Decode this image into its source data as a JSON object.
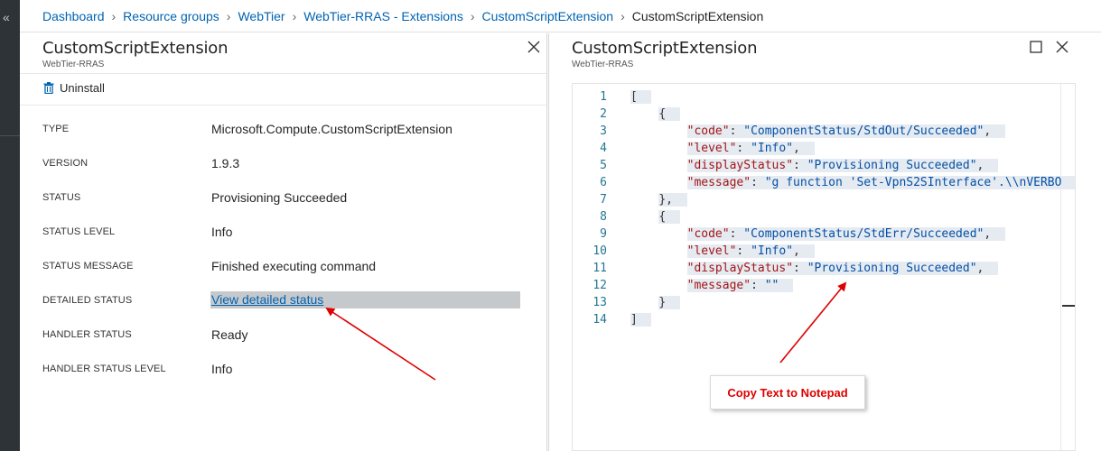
{
  "breadcrumb": {
    "items": [
      "Dashboard",
      "Resource groups",
      "WebTier",
      "WebTier-RRAS - Extensions",
      "CustomScriptExtension"
    ],
    "current": "CustomScriptExtension"
  },
  "rail": {
    "collapse_glyph": "«"
  },
  "left_pane": {
    "title": "CustomScriptExtension",
    "subtitle": "WebTier-RRAS",
    "uninstall_label": "Uninstall",
    "properties": [
      {
        "label": "TYPE",
        "value": "Microsoft.Compute.CustomScriptExtension"
      },
      {
        "label": "VERSION",
        "value": "1.9.3"
      },
      {
        "label": "STATUS",
        "value": "Provisioning Succeeded"
      },
      {
        "label": "STATUS LEVEL",
        "value": "Info"
      },
      {
        "label": "STATUS MESSAGE",
        "value": "Finished executing command"
      },
      {
        "label": "DETAILED STATUS",
        "value": "View detailed status"
      },
      {
        "label": "HANDLER STATUS",
        "value": "Ready"
      },
      {
        "label": "HANDLER STATUS LEVEL",
        "value": "Info"
      }
    ]
  },
  "right_pane": {
    "title": "CustomScriptExtension",
    "subtitle": "WebTier-RRAS",
    "code_lines": [
      {
        "n": "1",
        "text": "["
      },
      {
        "n": "2",
        "text": "    {"
      },
      {
        "n": "3",
        "indent": "        ",
        "key": "\"code\"",
        "value": "\"ComponentStatus/StdOut/Succeeded\"",
        "trail": ","
      },
      {
        "n": "4",
        "indent": "        ",
        "key": "\"level\"",
        "value": "\"Info\"",
        "trail": ","
      },
      {
        "n": "5",
        "indent": "        ",
        "key": "\"displayStatus\"",
        "value": "\"Provisioning Succeeded\"",
        "trail": ","
      },
      {
        "n": "6",
        "indent": "        ",
        "key": "\"message\"",
        "value": "\"g function 'Set-VpnS2SInterface'.\\\\nVERBO",
        "trail": ""
      },
      {
        "n": "7",
        "text": "    },"
      },
      {
        "n": "8",
        "text": "    {"
      },
      {
        "n": "9",
        "indent": "        ",
        "key": "\"code\"",
        "value": "\"ComponentStatus/StdErr/Succeeded\"",
        "trail": ","
      },
      {
        "n": "10",
        "indent": "        ",
        "key": "\"level\"",
        "value": "\"Info\"",
        "trail": ","
      },
      {
        "n": "11",
        "indent": "        ",
        "key": "\"displayStatus\"",
        "value": "\"Provisioning Succeeded\"",
        "trail": ","
      },
      {
        "n": "12",
        "indent": "        ",
        "key": "\"message\"",
        "value": "\"\"",
        "trail": ""
      },
      {
        "n": "13",
        "text": "    }"
      },
      {
        "n": "14",
        "text": "]"
      }
    ]
  },
  "annotation": {
    "callout_text": "Copy Text to Notepad"
  },
  "colors": {
    "link": "#0063b1",
    "annotation_red": "#e00000",
    "rail": "#2e3338",
    "json_key": "#a31515",
    "json_string": "#0451a5"
  }
}
